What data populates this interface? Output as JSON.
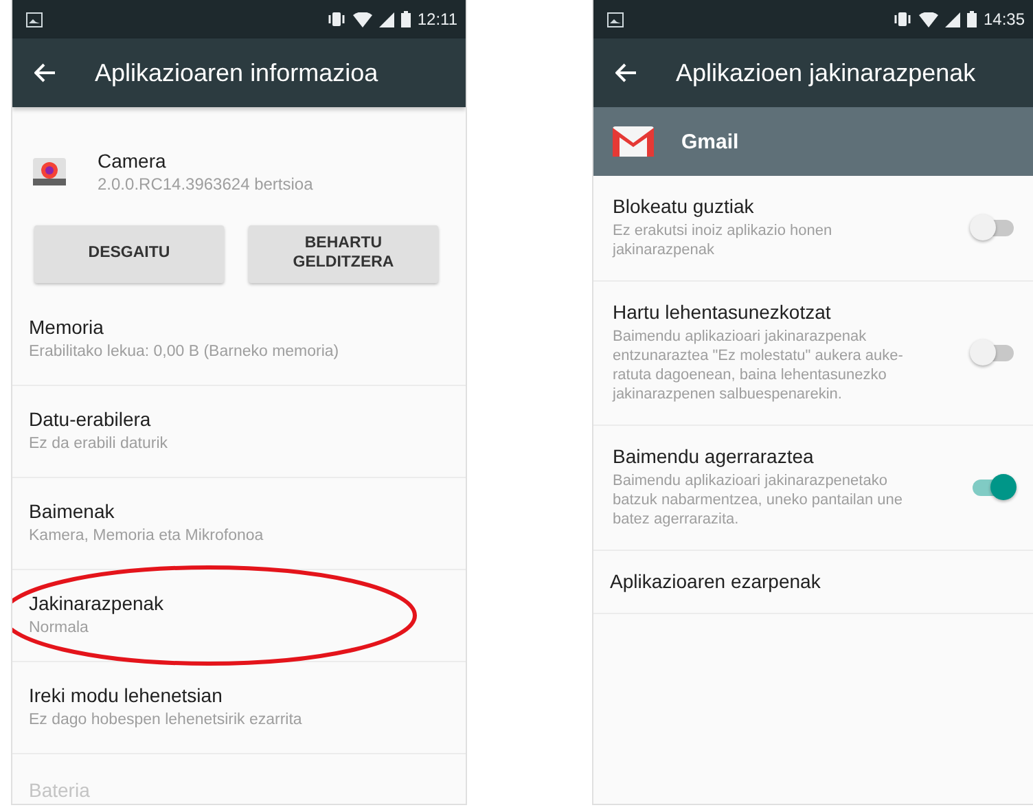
{
  "left_screen": {
    "status_bar": {
      "time": "12:11"
    },
    "toolbar": {
      "title": "Aplikazioaren informazioa"
    },
    "app": {
      "name": "Camera",
      "version": "2.0.0.RC14.3963624 bertsioa"
    },
    "buttons": [
      "DESGAITU",
      "BEHARTU GELDITZERA"
    ],
    "items": [
      {
        "title": "Memoria",
        "subtitle": "Erabilitako lekua: 0,00 B (Barneko memoria)",
        "disabled": false,
        "highlighted": false
      },
      {
        "title": "Datu-erabilera",
        "subtitle": "Ez da erabili daturik",
        "disabled": false,
        "highlighted": false
      },
      {
        "title": "Baimenak",
        "subtitle": "Kamera, Memoria eta Mikrofonoa",
        "disabled": false,
        "highlighted": false
      },
      {
        "title": "Jakinarazpenak",
        "subtitle": "Normala",
        "disabled": false,
        "highlighted": true
      },
      {
        "title": "Ireki modu lehenetsian",
        "subtitle": "Ez dago hobespen lehenetsirik ezarrita",
        "disabled": false,
        "highlighted": false
      },
      {
        "title": "Bateria",
        "disabled": true,
        "highlighted": false
      }
    ]
  },
  "right_screen": {
    "status_bar": {
      "time": "14:35"
    },
    "toolbar": {
      "title": "Aplikazioen jakinarazpenak"
    },
    "app_header": {
      "name": "Gmail"
    },
    "items": [
      {
        "kind": "toggle",
        "title": "Blokeatu guztiak",
        "subtitle": "Ez erakutsi inoiz aplikazio honen jakinarazpenak",
        "on": false
      },
      {
        "kind": "toggle",
        "title": "Hartu lehentasunezkotzat",
        "subtitle": "Baimendu aplikazioari jakinarazpenak entzunaraztea \"Ez molestatu\" aukera auke-ratuta dagoenean, baina lehentasunezko jakinarazpenen salbuespenarekin.",
        "on": false
      },
      {
        "kind": "toggle",
        "title": "Baimendu agerraraztea",
        "subtitle": "Baimendu aplikazioari jakinarazpenetako batzuk nabarmentzea, uneko pantailan une batez agerrarazita.",
        "on": true
      },
      {
        "kind": "link",
        "title": "Aplikazioaren ezarpenak"
      }
    ]
  }
}
